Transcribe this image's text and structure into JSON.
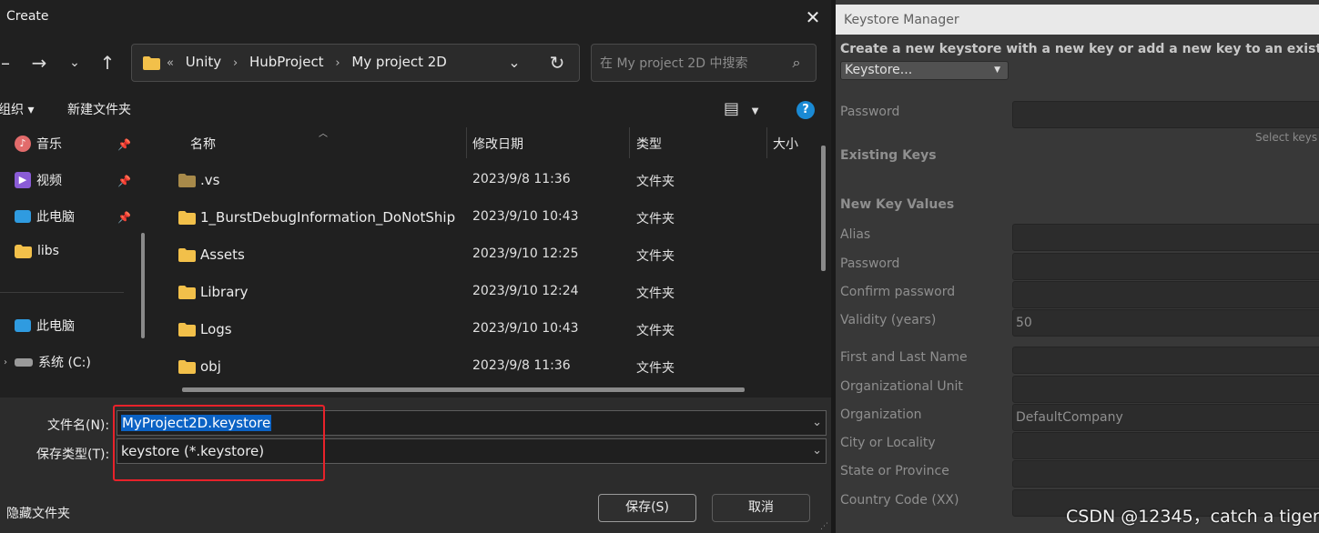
{
  "dialog": {
    "title": "Create",
    "address": {
      "overflow": "«",
      "crumbs": [
        "Unity",
        "HubProject",
        "My project 2D"
      ]
    },
    "search_placeholder": "在 My project 2D 中搜索",
    "toolbar": {
      "organize": "组织 ▾",
      "new_folder": "新建文件夹"
    },
    "nav": [
      {
        "label": "音乐",
        "icon": "music-icon",
        "pinned": true
      },
      {
        "label": "视频",
        "icon": "video-icon",
        "pinned": true
      },
      {
        "label": "此电脑",
        "icon": "computer-icon",
        "pinned": true
      },
      {
        "label": "libs",
        "icon": "folder-icon",
        "pinned": false
      },
      {
        "label": "此电脑",
        "icon": "computer-icon",
        "pinned": false
      },
      {
        "label": "系统 (C:)",
        "icon": "drive-icon",
        "pinned": false
      }
    ],
    "columns": [
      "名称",
      "修改日期",
      "类型",
      "大小"
    ],
    "files": [
      {
        "name": ".vs",
        "date": "2023/9/8 11:36",
        "type": "文件夹"
      },
      {
        "name": "1_BurstDebugInformation_DoNotShip",
        "date": "2023/9/10 10:43",
        "type": "文件夹"
      },
      {
        "name": "Assets",
        "date": "2023/9/10 12:25",
        "type": "文件夹"
      },
      {
        "name": "Library",
        "date": "2023/9/10 12:24",
        "type": "文件夹"
      },
      {
        "name": "Logs",
        "date": "2023/9/10 10:43",
        "type": "文件夹"
      },
      {
        "name": "obj",
        "date": "2023/9/8 11:36",
        "type": "文件夹"
      }
    ],
    "filename_label": "文件名(N):",
    "filename_value": "MyProject2D.keystore",
    "filetype_label": "保存类型(T):",
    "filetype_value": "keystore (*.keystore)",
    "hide_folders": "隐藏文件夹",
    "save_button": "保存(S)",
    "cancel_button": "取消"
  },
  "keystore": {
    "title": "Keystore Manager",
    "description": "Create a new keystore with a new key or add a new key to an existing k",
    "dropdown": "Keystore...",
    "password_label": "Password",
    "select_hint": "Select keys",
    "existing_keys": "Existing Keys",
    "new_key_values": "New Key Values",
    "fields": [
      {
        "label": "Alias",
        "value": ""
      },
      {
        "label": "Password",
        "value": ""
      },
      {
        "label": "Confirm password",
        "value": ""
      },
      {
        "label": "Validity (years)",
        "value": "50"
      },
      {
        "label": "First and Last Name",
        "value": ""
      },
      {
        "label": "Organizational Unit",
        "value": ""
      },
      {
        "label": "Organization",
        "value": "DefaultCompany"
      },
      {
        "label": "City or Locality",
        "value": ""
      },
      {
        "label": "State or Province",
        "value": ""
      },
      {
        "label": "Country Code (XX)",
        "value": ""
      }
    ]
  },
  "watermark": "CSDN @12345，catch a tiger",
  "colors": {
    "highlight": "#e8222a",
    "selection": "#0b62c4",
    "folder": "#f2c04a"
  }
}
